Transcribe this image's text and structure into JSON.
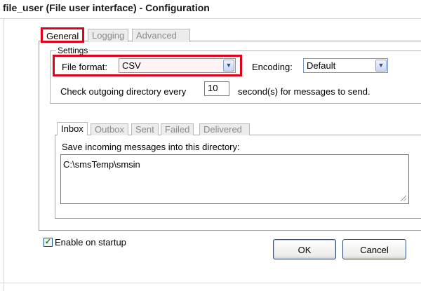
{
  "window": {
    "title": "file_user (File user interface) - Configuration"
  },
  "main_tabs": [
    {
      "label": "General",
      "active": true
    },
    {
      "label": "Logging",
      "active": false
    },
    {
      "label": "Advanced",
      "active": false
    }
  ],
  "settings": {
    "legend": "Settings",
    "file_format_label": "File format:",
    "file_format_value": "CSV",
    "encoding_label": "Encoding:",
    "encoding_value": "Default",
    "check_label": "Check outgoing directory every",
    "check_interval": "10",
    "check_suffix": "second(s) for messages to send."
  },
  "dir_tabs": [
    {
      "label": "Inbox",
      "active": true
    },
    {
      "label": "Outbox",
      "active": false
    },
    {
      "label": "Sent",
      "active": false
    },
    {
      "label": "Failed",
      "active": false
    },
    {
      "label": "Delivered",
      "active": false
    }
  ],
  "inbox": {
    "label": "Save incoming messages into this directory:",
    "path": "C:\\smsTemp\\smsin"
  },
  "footer": {
    "startup_label": "Enable on startup",
    "startup_checked": true,
    "ok_label": "OK",
    "cancel_label": "Cancel"
  },
  "colors": {
    "highlight": "#e0001a",
    "check": "#1a7a1a"
  }
}
